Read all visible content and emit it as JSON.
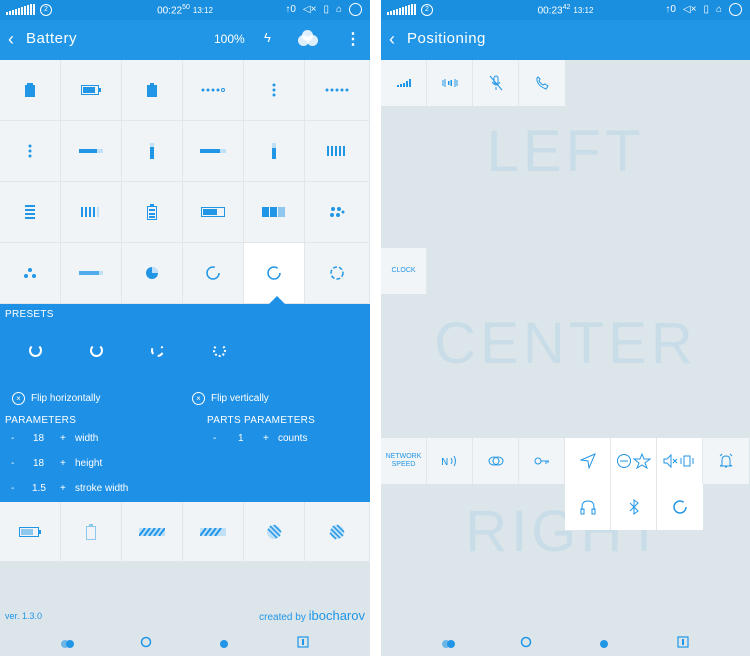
{
  "left": {
    "status": {
      "time_main": "00:22",
      "time_sec": "50",
      "time_date": "13:12",
      "badge": "2"
    },
    "appbar": {
      "title": "Battery",
      "percent": "100%"
    },
    "panel": {
      "presets_label": "PRESETS",
      "flip_h": "Flip horizontally",
      "flip_v": "Flip vertically",
      "params_label": "PARAMETERS",
      "parts_label": "PARTS PARAMETERS",
      "params": [
        {
          "value": "18",
          "name": "width"
        },
        {
          "value": "18",
          "name": "height"
        },
        {
          "value": "1.5",
          "name": "stroke width"
        }
      ],
      "parts": [
        {
          "value": "1",
          "name": "counts"
        }
      ],
      "minus": "-",
      "plus": "+"
    },
    "footer": {
      "version": "ver. 1.3.0",
      "credit_prefix": "created by ",
      "credit_name": "ibocharov"
    }
  },
  "right": {
    "status": {
      "time_main": "00:23",
      "time_sec": "42",
      "time_date": "13:12",
      "badge": "2"
    },
    "appbar": {
      "title": "Positioning"
    },
    "sections": {
      "left": "LEFT",
      "center": "CENTER",
      "right": "RIGHT"
    },
    "clock_label": "CLOCK",
    "network_label_1": "NETWORK",
    "network_label_2": "SPEED"
  },
  "colors": {
    "accent": "#2196e6",
    "status": "#1a8fe0",
    "panel": "#1e90e6",
    "bg": "#dbe5ea"
  }
}
